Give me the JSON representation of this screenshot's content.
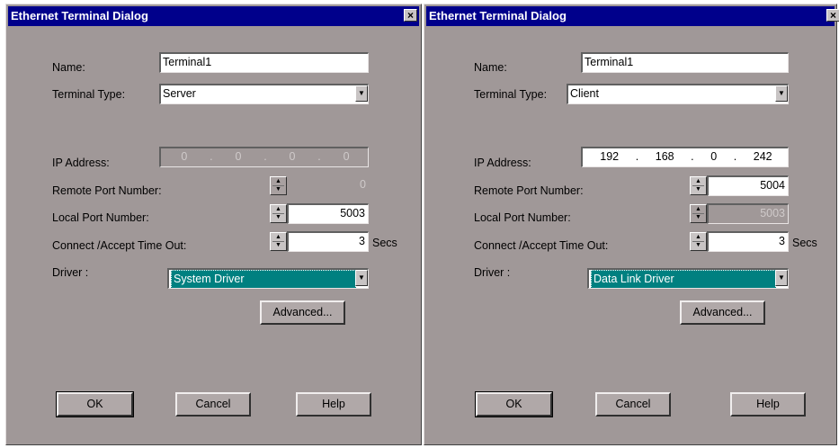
{
  "left": {
    "title": "Ethernet Terminal Dialog",
    "close_label": "×",
    "name_label": "Name:",
    "name_value": "Terminal1",
    "type_label": "Terminal Type:",
    "type_value": "Server",
    "ip_label": "IP Address:",
    "ip_octets": [
      "0",
      "0",
      "0",
      "0"
    ],
    "remote_label": "Remote Port Number:",
    "remote_value": "0",
    "local_label": "Local Port Number:",
    "local_value": "5003",
    "timeout_label": "Connect /Accept Time Out:",
    "timeout_value": "3",
    "timeout_unit": "Secs",
    "driver_label": "Driver :",
    "driver_value": "System Driver",
    "advanced_label": "Advanced...",
    "ok_label": "OK",
    "cancel_label": "Cancel",
    "help_label": "Help"
  },
  "right": {
    "title": "Ethernet Terminal Dialog",
    "close_label": "×",
    "name_label": "Name:",
    "name_value": "Terminal1",
    "type_label": "Terminal Type:",
    "type_value": "Client",
    "ip_label": "IP Address:",
    "ip_octets": [
      "192",
      "168",
      "0",
      "242"
    ],
    "remote_label": "Remote Port Number:",
    "remote_value": "5004",
    "local_label": "Local Port Number:",
    "local_value": "5003",
    "timeout_label": "Connect /Accept Time Out:",
    "timeout_value": "3",
    "timeout_unit": "Secs",
    "driver_label": "Driver :",
    "driver_value": "Data Link Driver",
    "advanced_label": "Advanced...",
    "ok_label": "OK",
    "cancel_label": "Cancel",
    "help_label": "Help"
  },
  "colors": {
    "dialog_bg": "#a09898",
    "titlebar": "#00008b",
    "selection": "#008080"
  }
}
